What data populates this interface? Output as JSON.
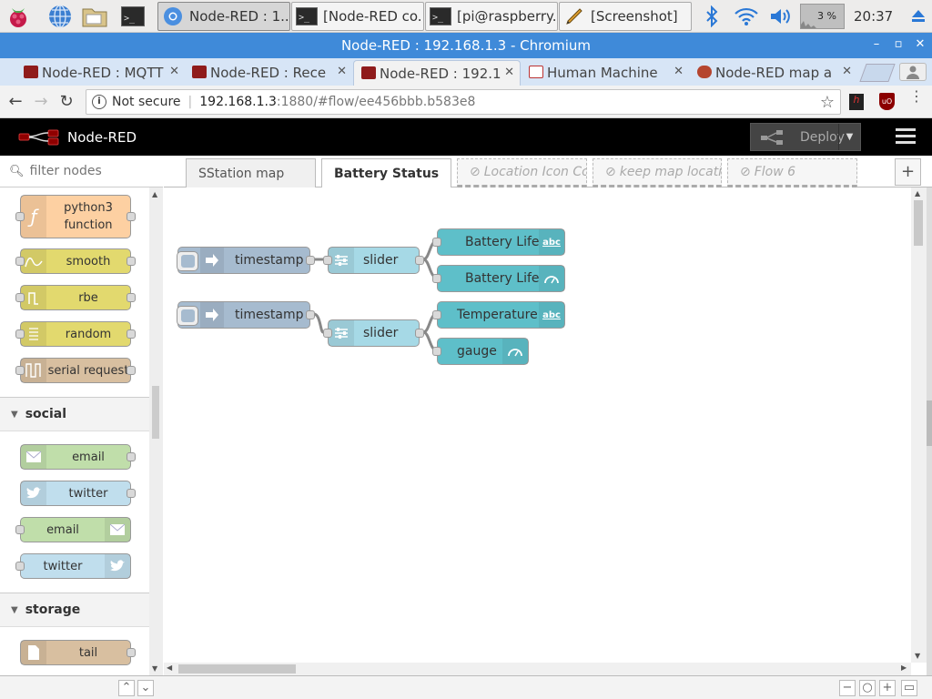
{
  "taskbar": {
    "tasks": [
      {
        "label": "Node-RED : 1..."
      },
      {
        "label": "[Node-RED co..."
      },
      {
        "label": "[pi@raspberry..."
      },
      {
        "label": "[Screenshot]"
      }
    ],
    "cpu": "3 %",
    "clock": "20:37"
  },
  "window": {
    "title": "Node-RED : 192.168.1.3 - Chromium"
  },
  "browser_tabs": [
    {
      "label": "Node-RED : MQTT"
    },
    {
      "label": "Node-RED : Rece"
    },
    {
      "label": "Node-RED : 192.1"
    },
    {
      "label": "Human Machine"
    },
    {
      "label": "Node-RED map a"
    }
  ],
  "addressbar": {
    "security": "Not secure",
    "host": "192.168.1.3",
    "path": ":1880/#flow/ee456bbb.b583e8"
  },
  "nodered": {
    "brand": "Node-RED",
    "deploy": "Deploy",
    "filter_placeholder": "filter nodes"
  },
  "palette": {
    "nodes_top": [
      {
        "label": "python3\nfunction"
      },
      {
        "label": "smooth"
      },
      {
        "label": "rbe"
      },
      {
        "label": "random"
      },
      {
        "label": "serial request"
      }
    ],
    "categories": [
      {
        "name": "social",
        "nodes": [
          {
            "label": "email"
          },
          {
            "label": "twitter"
          },
          {
            "label": "email"
          },
          {
            "label": "twitter"
          }
        ]
      },
      {
        "name": "storage",
        "nodes": [
          {
            "label": "tail"
          }
        ]
      }
    ]
  },
  "workspace_tabs": [
    {
      "label": "SStation map"
    },
    {
      "label": "Battery Status"
    },
    {
      "label": "Location Icon Colo"
    },
    {
      "label": "keep map location"
    },
    {
      "label": "Flow 6"
    }
  ],
  "flow": {
    "nodes": [
      {
        "id": "ts1",
        "label": "timestamp"
      },
      {
        "id": "sl1",
        "label": "slider"
      },
      {
        "id": "bl1",
        "label": "Battery Life",
        "badge": "abc"
      },
      {
        "id": "bl2",
        "label": "Battery Life"
      },
      {
        "id": "ts2",
        "label": "timestamp"
      },
      {
        "id": "sl2",
        "label": "slider"
      },
      {
        "id": "tmp",
        "label": "Temperature",
        "badge": "abc"
      },
      {
        "id": "gau",
        "label": "gauge"
      }
    ]
  }
}
